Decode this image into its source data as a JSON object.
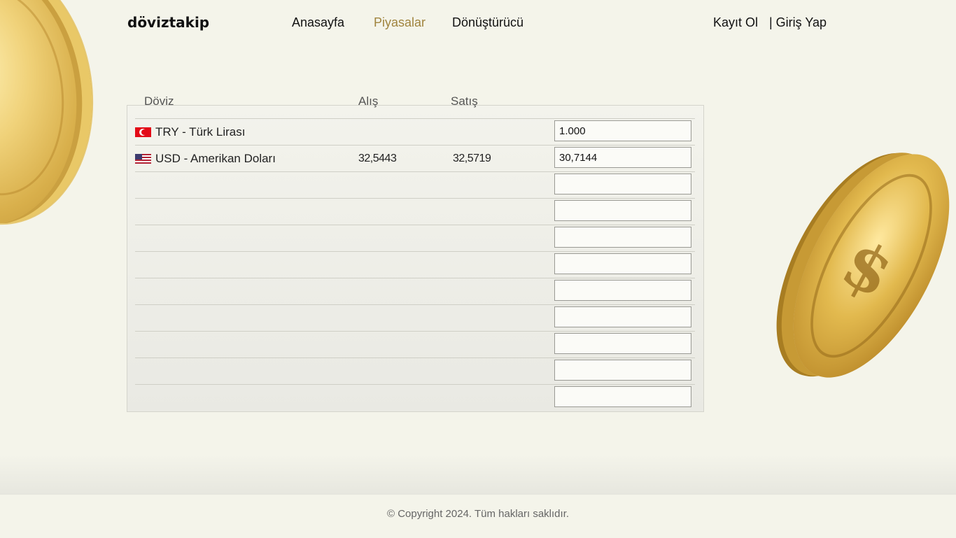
{
  "header": {
    "brand": "döviztakip",
    "nav": [
      {
        "label": "Anasayfa"
      },
      {
        "label": "Piyasalar"
      },
      {
        "label": "Dönüştürücü"
      }
    ],
    "active_nav": "Piyasalar",
    "register": "Kayıt Ol",
    "login": "| Giriş Yap"
  },
  "table": {
    "headers": {
      "currency": "Döviz",
      "buy": "Alış",
      "sell": "Satış"
    },
    "rows": [
      {
        "flag": "tr-flag-icon",
        "name": "TRY - Türk Lirası",
        "buy": "",
        "sell": "",
        "amount": "1.000"
      },
      {
        "flag": "us-flag-icon",
        "name": "USD - Amerikan Doları",
        "buy": "32,5443",
        "sell": "32,5719",
        "amount": "30,7144"
      },
      {
        "name": "",
        "buy": "",
        "sell": "",
        "amount": ""
      },
      {
        "name": "",
        "buy": "",
        "sell": "",
        "amount": ""
      },
      {
        "name": "",
        "buy": "",
        "sell": "",
        "amount": ""
      },
      {
        "name": "",
        "buy": "",
        "sell": "",
        "amount": ""
      },
      {
        "name": "",
        "buy": "",
        "sell": "",
        "amount": ""
      },
      {
        "name": "",
        "buy": "",
        "sell": "",
        "amount": ""
      },
      {
        "name": "",
        "buy": "",
        "sell": "",
        "amount": ""
      },
      {
        "name": "",
        "buy": "",
        "sell": "",
        "amount": ""
      },
      {
        "name": "",
        "buy": "",
        "sell": "",
        "amount": ""
      }
    ]
  },
  "footer": {
    "copyright": "© Copyright 2024. Tüm hakları saklıdır."
  },
  "colors": {
    "background": "#f4f4ea",
    "accent": "#a0843e"
  }
}
